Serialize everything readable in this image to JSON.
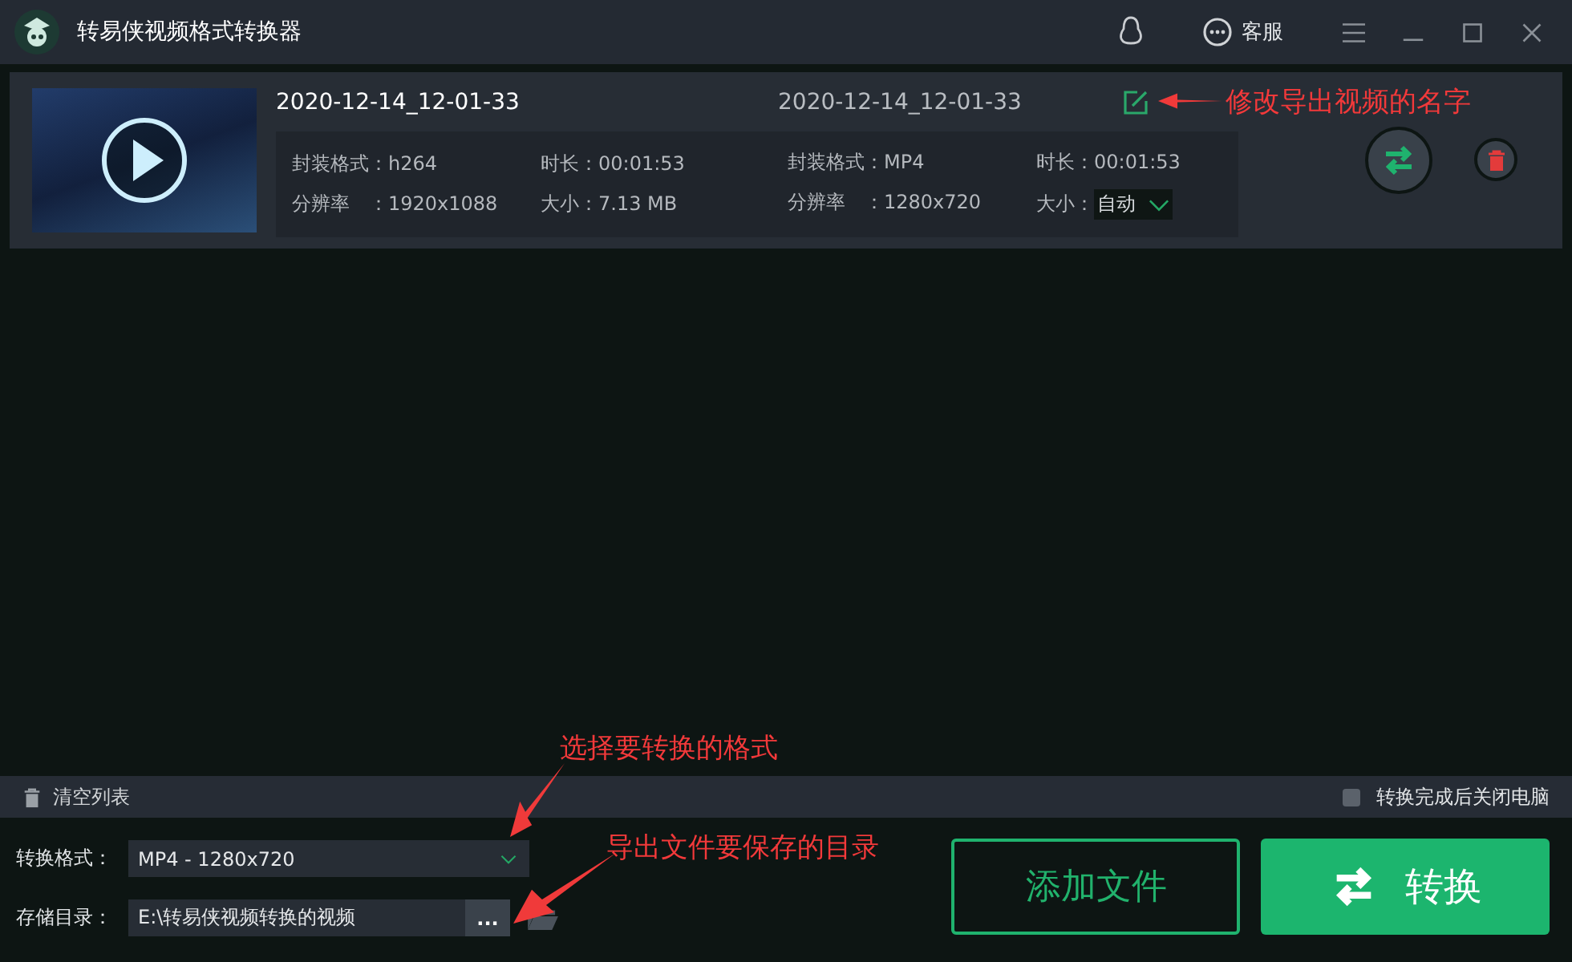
{
  "window": {
    "title": "转易侠视频格式转换器"
  },
  "titlebar": {
    "support_label": "客服"
  },
  "files": [
    {
      "name": "2020-12-14_12-01-33",
      "output_name": "2020-12-14_12-01-33",
      "source": [
        {
          "label": "封装格式：",
          "value": "h264"
        },
        {
          "label": "时长：",
          "value": "00:01:53"
        },
        {
          "label": "分辨率　：",
          "value": "1920x1088"
        },
        {
          "label": "大小：",
          "value": "7.13 MB"
        }
      ],
      "output": [
        {
          "label": "封装格式：",
          "value": "MP4"
        },
        {
          "label": "时长：",
          "value": "00:01:53"
        },
        {
          "label": "分辨率　：",
          "value": "1280x720"
        }
      ],
      "size": {
        "label": "大小：",
        "value": "自动"
      }
    }
  ],
  "toolbar": {
    "clear_label": "清空列表",
    "shutdown_after": {
      "label": "转换完成后关闭电脑",
      "checked": false
    }
  },
  "format": {
    "label": "转换格式：",
    "value": "MP4 - 1280x720"
  },
  "output_dir": {
    "label": "存储目录：",
    "value": "E:\\转易侠视频转换的视频",
    "browse_label": "..."
  },
  "buttons": {
    "add": "添加文件",
    "convert": "转换"
  },
  "annotations": [
    {
      "kind": "rename",
      "text": "修改导出视频的名字"
    },
    {
      "kind": "format",
      "text": "选择要转换的格式"
    },
    {
      "kind": "dir",
      "text": "导出文件要保存的目录"
    }
  ]
}
